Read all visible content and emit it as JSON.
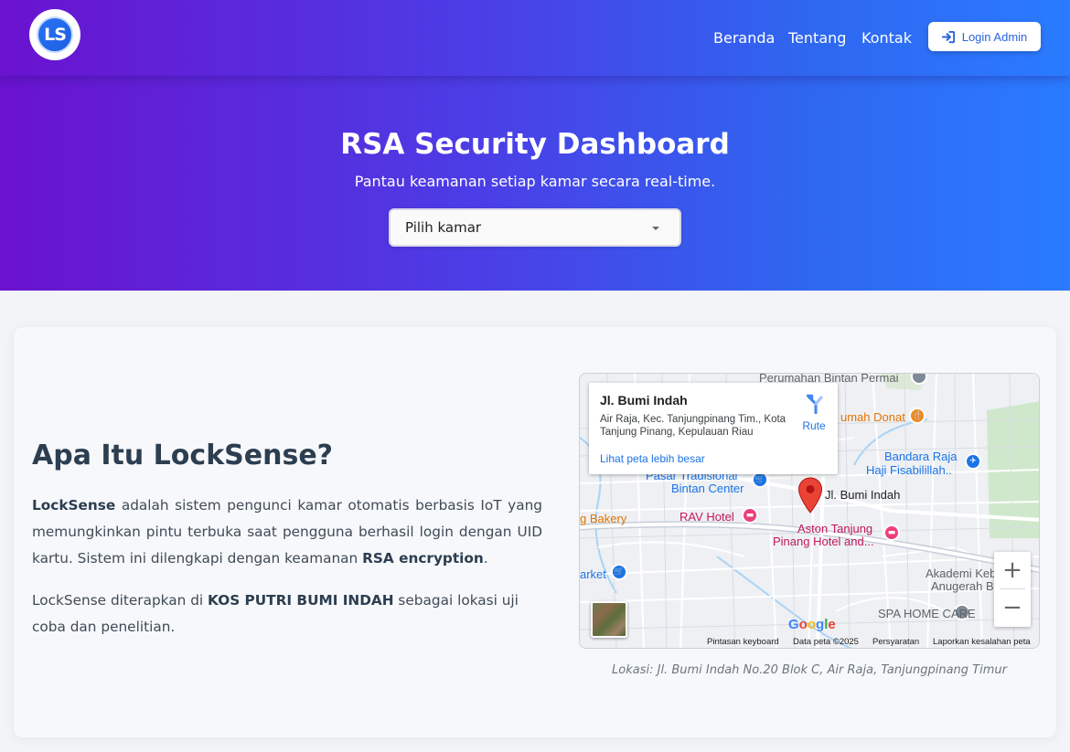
{
  "brand": {
    "logo_text": "LS"
  },
  "nav": {
    "links": [
      "Beranda",
      "Tentang",
      "Kontak"
    ],
    "login_label": "Login Admin"
  },
  "hero": {
    "title": "RSA Security Dashboard",
    "subtitle": "Pantau keamanan setiap kamar secara real-time.",
    "select_value": "Pilih kamar"
  },
  "about": {
    "title": "Apa Itu LockSense?",
    "p1_brand": "LockSense",
    "p1_text1": " adalah sistem pengunci kamar otomatis berbasis IoT yang memungkinkan pintu terbuka saat pengguna berhasil login dengan UID kartu. Sistem ini dilengkapi dengan keamanan ",
    "p1_bold2": "RSA encryption",
    "p1_text2": ".",
    "p2_text1": "LockSense diterapkan di ",
    "p2_bold": "KOS PUTRI BUMI INDAH",
    "p2_text2": " sebagai lokasi uji coba dan penelitian."
  },
  "map": {
    "place_name": "Jl. Bumi Indah",
    "address": "Air Raja, Kec. Tanjungpinang Tim., Kota Tanjung Pinang, Kepulauan Riau",
    "route_label": "Rute",
    "larger_map_label": "Lihat peta lebih besar",
    "labels": {
      "perumahan": "Perumahan Bintan Permai",
      "rumah_donat": "umah Donat",
      "bandara1": "Bandara Raja",
      "bandara2": "Haji Fisabilillah..",
      "pasar1": "Pasar Tradisional",
      "pasar2": "Bintan Center",
      "pin": "Jl. Bumi Indah",
      "bakery": "g Bakery",
      "rav": "RAV Hotel",
      "aston1": "Aston Tanjung",
      "aston2": "Pinang Hotel and...",
      "market": "arket",
      "akademi1": "Akademi Kebidan",
      "akademi2": "Anugerah Bin",
      "spa": "SPA HOME CARE"
    },
    "attribution": {
      "keyboard": "Pintasan keyboard",
      "data": "Data peta ©2025",
      "terms": "Persyaratan",
      "report": "Laporkan kesalahan peta"
    },
    "google": "Google",
    "caption": "Lokasi: Jl. Bumi Indah No.20 Blok C, Air Raja, Tanjungpinang Timur"
  }
}
